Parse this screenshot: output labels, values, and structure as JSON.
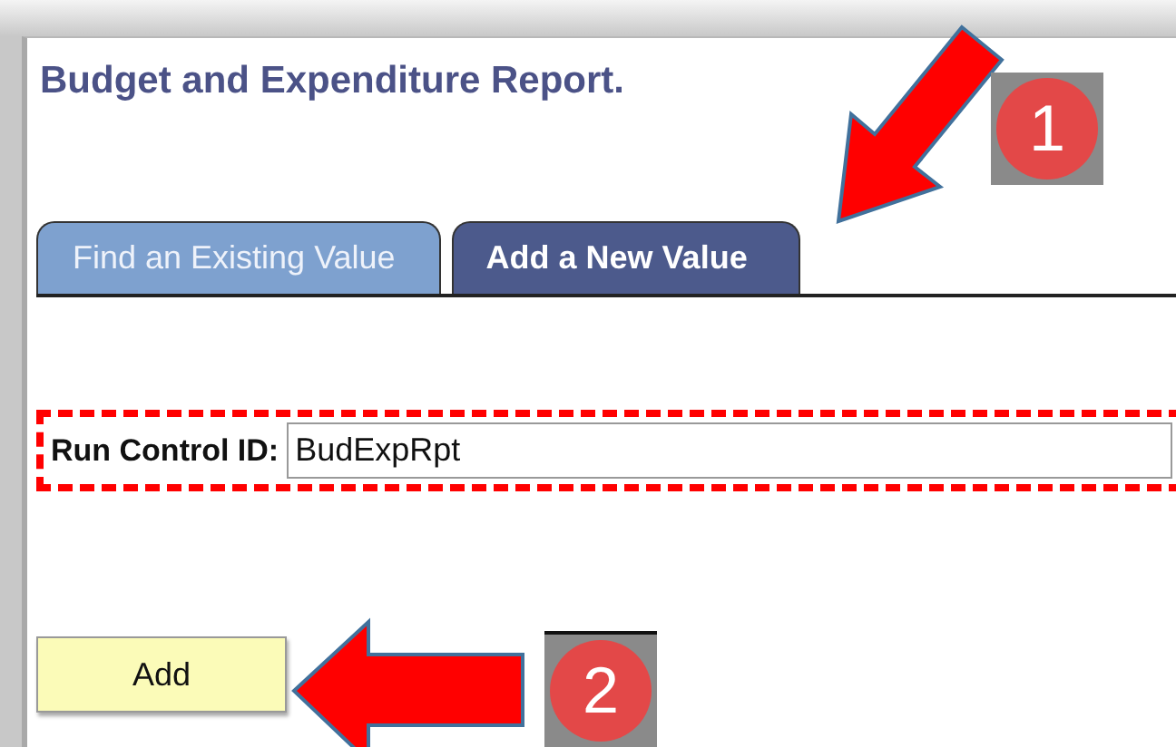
{
  "page": {
    "title": "Budget and Expenditure Report."
  },
  "tabs": [
    {
      "label": "Find an Existing Value",
      "selected": false
    },
    {
      "label": "Add a New Value",
      "selected": true
    }
  ],
  "run_control": {
    "label": "Run Control ID:",
    "value": "BudExpRpt"
  },
  "add_button": {
    "label": "Add"
  },
  "step_badges": [
    "1",
    "2"
  ]
}
